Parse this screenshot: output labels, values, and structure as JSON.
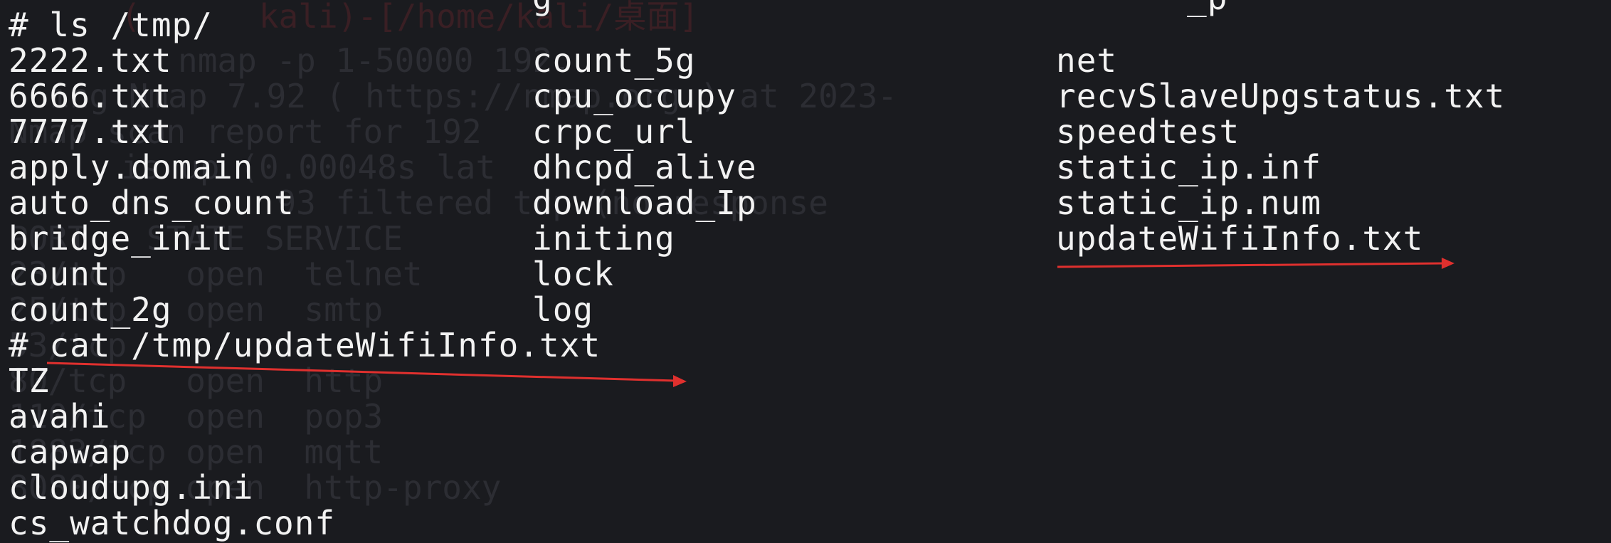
{
  "ghost": {
    "header": "(      kali)-[/home/kali/桌面]",
    "lines": [
      "nmap -p 1-50000 192.",
      "ing Nmap 7.92 ( https://nmap.org ) at 2023-",
      "Nmap scan report for 192",
      "is up (0.00048s lat",
      "     93 filtered tcp (no-response",
      "PORT   STATE SERVICE",
      "23/tcp   open  telnet",
      "25/tcp   open  smtp",
      "53/tcp",
      "80/tcp   open  http",
      "110/tcp  open  pop3",
      "1883/tcp open  mqtt",
      "8080/tcp open  http-proxy"
    ]
  },
  "terminal": {
    "top_partial_col2": "g",
    "top_partial_col3": "_p",
    "command1": "# ls /tmp/",
    "ls_columns": [
      [
        "2222.txt",
        "6666.txt",
        "7777.txt",
        "apply.domain",
        "auto_dns_count",
        "bridge_init",
        "count",
        "count_2g"
      ],
      [
        "count_5g",
        "cpu_occupy",
        "crpc_url",
        "dhcpd_alive",
        "download_Ip",
        "initing",
        "lock",
        "log"
      ],
      [
        "net",
        "recvSlaveUpgstatus.txt",
        "speedtest",
        "static_ip.inf",
        "static_ip.num",
        "updateWifiInfo.txt"
      ]
    ],
    "command2": "# cat /tmp/updateWifiInfo.txt",
    "cat_output": [
      "TZ",
      "avahi",
      "capwap",
      "cloudupg.ini",
      "cs_watchdog.conf"
    ]
  },
  "annotations": {
    "arrow_color": "#e0302e"
  }
}
